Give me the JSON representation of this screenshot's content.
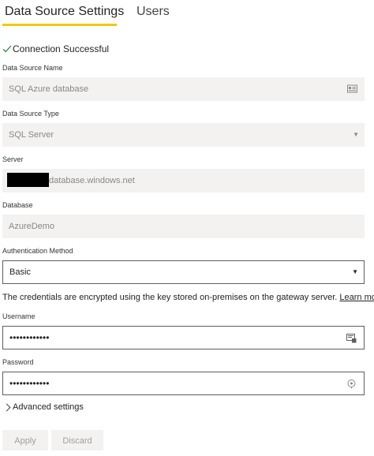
{
  "tabs": [
    {
      "label": "Data Source Settings",
      "active": true
    },
    {
      "label": "Users",
      "active": false
    }
  ],
  "accent_color": "#f2c811",
  "status": {
    "text": "Connection Successful",
    "icon": "check-icon",
    "icon_color": "#2e8b3a"
  },
  "data_source_name": {
    "label": "Data Source Name",
    "value": "SQL Azure database",
    "icon": "id-card-icon"
  },
  "data_source_type": {
    "label": "Data Source Type",
    "value": "SQL Server"
  },
  "server": {
    "label": "Server",
    "value_suffix": "database.windows.net",
    "redacted": true
  },
  "database": {
    "label": "Database",
    "value": "AzureDemo"
  },
  "auth_method": {
    "label": "Authentication Method",
    "value": "Basic"
  },
  "credentials_note": {
    "text": "The credentials are encrypted using the key stored on-premises on the gateway server.",
    "link": "Learn more"
  },
  "username": {
    "label": "Username",
    "value": "••••••••••••",
    "icon": "credential-icon"
  },
  "password": {
    "label": "Password",
    "value": "••••••••••••",
    "icon": "reveal-password-icon"
  },
  "advanced": {
    "label": "Advanced settings"
  },
  "buttons": {
    "apply": "Apply",
    "discard": "Discard"
  }
}
